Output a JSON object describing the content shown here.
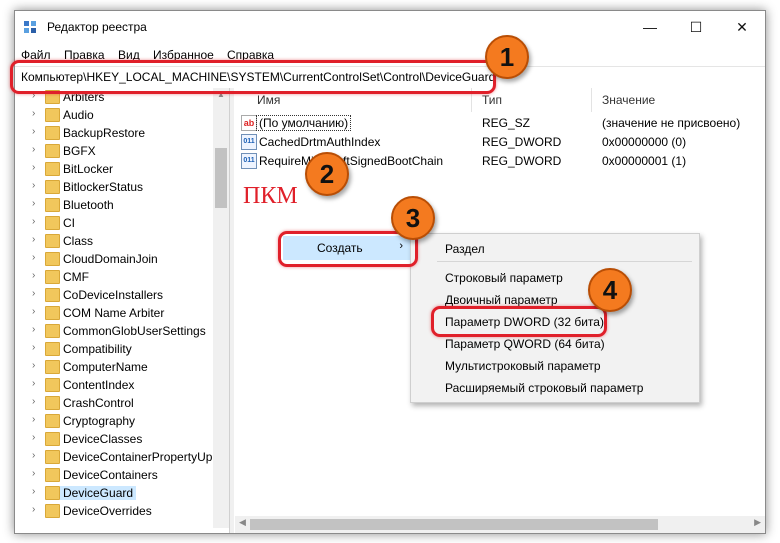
{
  "window": {
    "title": "Редактор реестра",
    "controls": {
      "minimize": "—",
      "maximize": "☐",
      "close": "✕"
    }
  },
  "menu": [
    "Файл",
    "Правка",
    "Вид",
    "Избранное",
    "Справка"
  ],
  "address": "Компьютер\\HKEY_LOCAL_MACHINE\\SYSTEM\\CurrentControlSet\\Control\\DeviceGuard",
  "tree": {
    "items": [
      "Arbiters",
      "Audio",
      "BackupRestore",
      "BGFX",
      "BitLocker",
      "BitlockerStatus",
      "Bluetooth",
      "CI",
      "Class",
      "CloudDomainJoin",
      "CMF",
      "CoDeviceInstallers",
      "COM Name Arbiter",
      "CommonGlobUserSettings",
      "Compatibility",
      "ComputerName",
      "ContentIndex",
      "CrashControl",
      "Cryptography",
      "DeviceClasses",
      "DeviceContainerPropertyUp",
      "DeviceContainers",
      "DeviceGuard",
      "DeviceOverrides"
    ],
    "selected": "DeviceGuard"
  },
  "list": {
    "columns": [
      "Имя",
      "Тип",
      "Значение"
    ],
    "rows": [
      {
        "icon": "string-value-icon",
        "name": "(По умолчанию)",
        "type": "REG_SZ",
        "data": "(значение не присвоено)"
      },
      {
        "icon": "binary-value-icon",
        "name": "CachedDrtmAuthIndex",
        "type": "REG_DWORD",
        "data": "0x00000000 (0)"
      },
      {
        "icon": "binary-value-icon",
        "name": "RequireMicrosoftSignedBootChain",
        "type": "REG_DWORD",
        "data": "0x00000001 (1)"
      }
    ]
  },
  "annotation": {
    "rmb_label": "ПКМ",
    "steps": [
      "1",
      "2",
      "3",
      "4"
    ],
    "accent": "#e0202a",
    "badge_color": "#f47a1f"
  },
  "context_menu": {
    "create": "Создать",
    "submenu": [
      "Раздел",
      "Строковый параметр",
      "Двоичный параметр",
      "Параметр DWORD (32 бита)",
      "Параметр QWORD (64 бита)",
      "Мультистроковый параметр",
      "Расширяемый строковый параметр"
    ]
  }
}
